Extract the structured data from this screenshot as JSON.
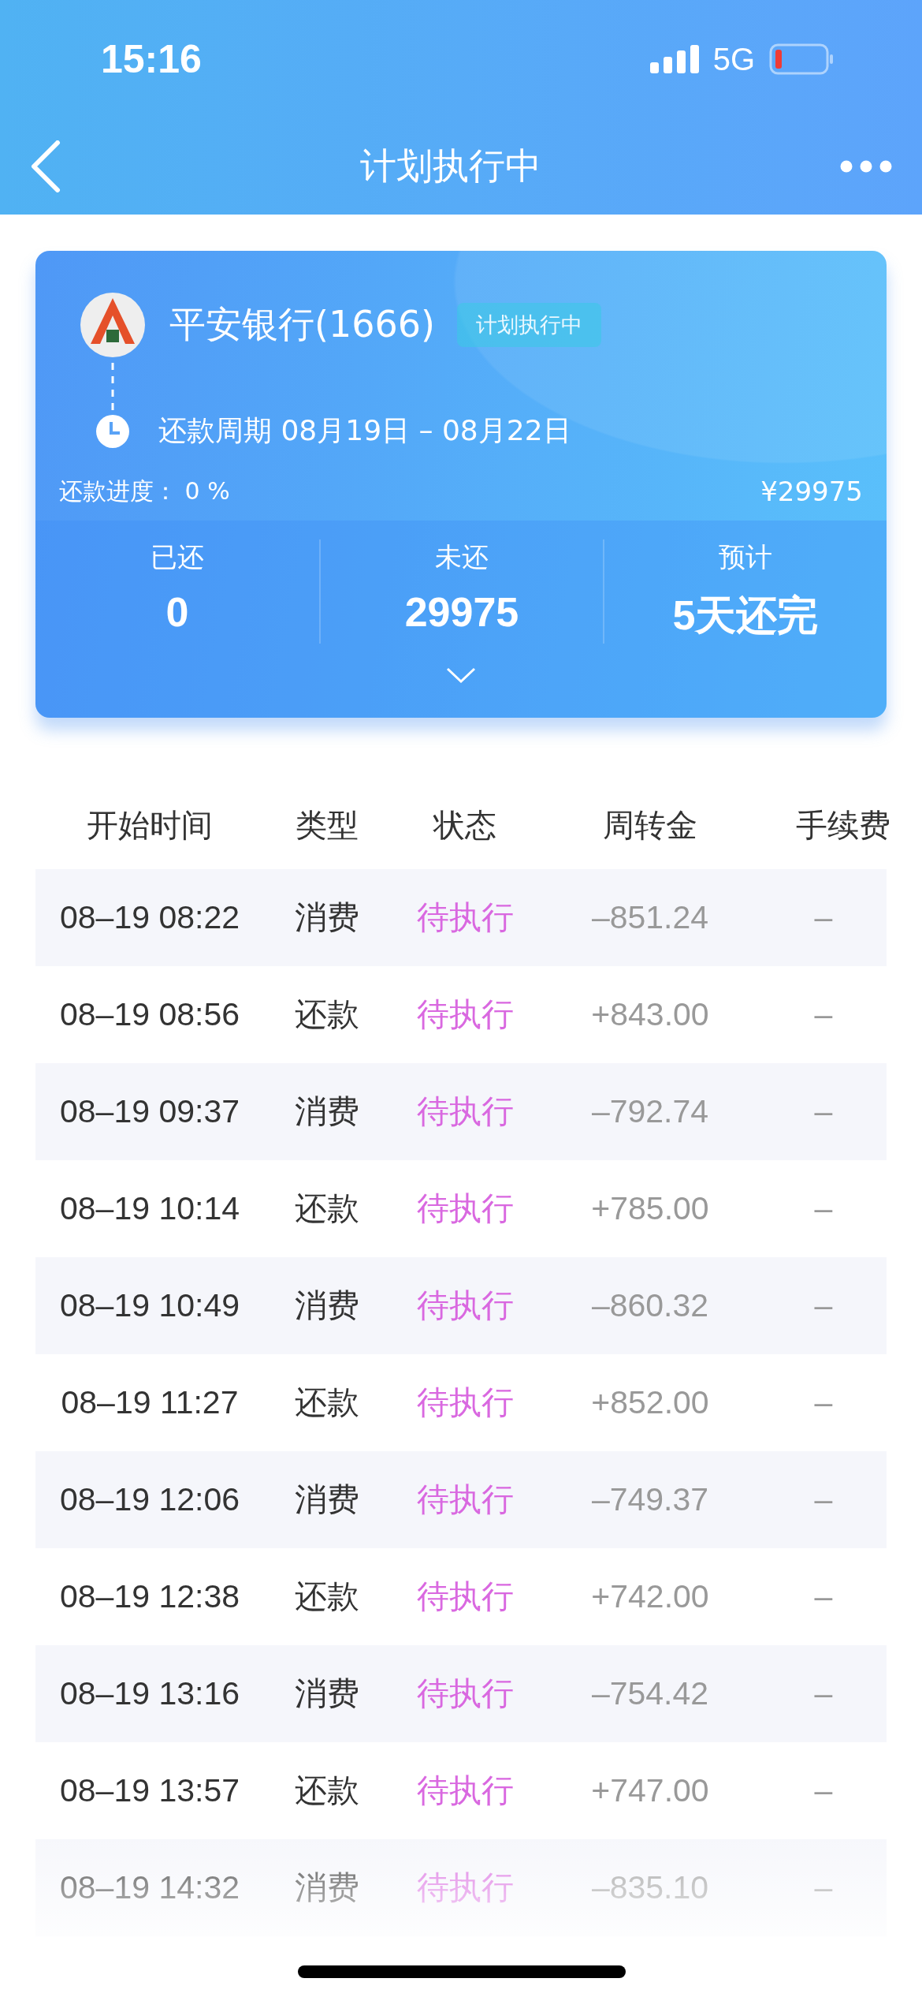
{
  "status_bar": {
    "time": "15:16",
    "network": "5G"
  },
  "nav": {
    "title": "计划执行中"
  },
  "card": {
    "bank": "平安银行(1666)",
    "badge": "计划执行中",
    "period_label": "还款周期",
    "period": "08月19日 – 08月22日",
    "progress_label": "还款进度：",
    "progress": "0 %",
    "total": "¥29975",
    "stats": [
      {
        "label": "已还",
        "value": "0"
      },
      {
        "label": "未还",
        "value": "29975"
      },
      {
        "label": "预计",
        "value": "5天还完"
      }
    ]
  },
  "table": {
    "columns": [
      "开始时间",
      "类型",
      "状态",
      "周转金",
      "手续费"
    ],
    "rows": [
      {
        "time": "08–19 08:22",
        "type": "消费",
        "status": "待执行",
        "amount": "–851.24",
        "fee": "–"
      },
      {
        "time": "08–19 08:56",
        "type": "还款",
        "status": "待执行",
        "amount": "+843.00",
        "fee": "–"
      },
      {
        "time": "08–19 09:37",
        "type": "消费",
        "status": "待执行",
        "amount": "–792.74",
        "fee": "–"
      },
      {
        "time": "08–19 10:14",
        "type": "还款",
        "status": "待执行",
        "amount": "+785.00",
        "fee": "–"
      },
      {
        "time": "08–19 10:49",
        "type": "消费",
        "status": "待执行",
        "amount": "–860.32",
        "fee": "–"
      },
      {
        "time": "08–19 11:27",
        "type": "还款",
        "status": "待执行",
        "amount": "+852.00",
        "fee": "–"
      },
      {
        "time": "08–19 12:06",
        "type": "消费",
        "status": "待执行",
        "amount": "–749.37",
        "fee": "–"
      },
      {
        "time": "08–19 12:38",
        "type": "还款",
        "status": "待执行",
        "amount": "+742.00",
        "fee": "–"
      },
      {
        "time": "08–19 13:16",
        "type": "消费",
        "status": "待执行",
        "amount": "–754.42",
        "fee": "–"
      },
      {
        "time": "08–19 13:57",
        "type": "还款",
        "status": "待执行",
        "amount": "+747.00",
        "fee": "–"
      },
      {
        "time": "08–19 14:32",
        "type": "消费",
        "status": "待执行",
        "amount": "–835.10",
        "fee": "–"
      }
    ]
  }
}
